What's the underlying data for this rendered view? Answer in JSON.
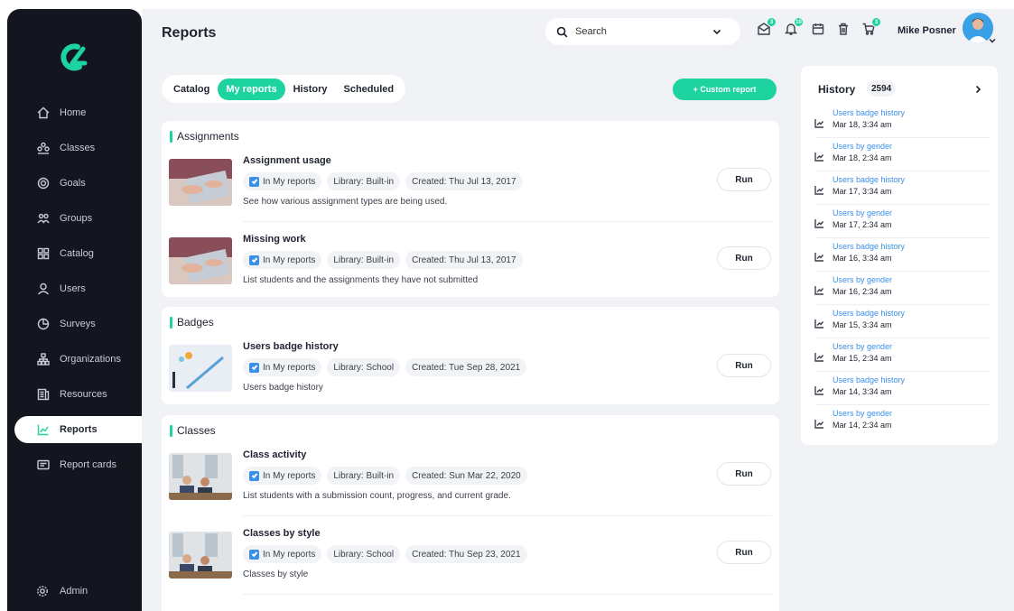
{
  "page": {
    "title": "Reports"
  },
  "sidebar": {
    "items": [
      {
        "label": "Home",
        "icon": "home-icon"
      },
      {
        "label": "Classes",
        "icon": "classes-icon"
      },
      {
        "label": "Goals",
        "icon": "goals-icon"
      },
      {
        "label": "Groups",
        "icon": "groups-icon"
      },
      {
        "label": "Catalog",
        "icon": "catalog-icon"
      },
      {
        "label": "Users",
        "icon": "user-icon"
      },
      {
        "label": "Surveys",
        "icon": "surveys-icon"
      },
      {
        "label": "Organizations",
        "icon": "organizations-icon"
      },
      {
        "label": "Resources",
        "icon": "resources-icon"
      },
      {
        "label": "Reports",
        "icon": "reports-icon",
        "active": true
      },
      {
        "label": "Report cards",
        "icon": "report-cards-icon"
      }
    ],
    "admin_label": "Admin"
  },
  "topbar": {
    "search_placeholder": "Search",
    "user_name": "Mike Posner",
    "badges": {
      "messages": "3",
      "notifications": "10",
      "cart": "3"
    }
  },
  "tabs": [
    {
      "label": "Catalog",
      "active": false
    },
    {
      "label": "My reports",
      "active": true
    },
    {
      "label": "History",
      "active": false
    },
    {
      "label": "Scheduled",
      "active": false
    }
  ],
  "custom_report_label": "+ Custom report",
  "sections": [
    {
      "title": "Assignments",
      "reports": [
        {
          "title": "Assignment usage",
          "in_my_reports": "In My reports",
          "library": "Library: Built-in",
          "created": "Created: Thu Jul 13, 2017",
          "description": "See how various assignment types are being used.",
          "run": "Run"
        },
        {
          "title": "Missing work",
          "in_my_reports": "In My reports",
          "library": "Library: Built-in",
          "created": "Created: Thu Jul 13, 2017",
          "description": "List students and the assignments they have not submitted",
          "run": "Run"
        }
      ]
    },
    {
      "title": "Badges",
      "reports": [
        {
          "title": "Users badge history",
          "in_my_reports": "In My reports",
          "library": "Library: School",
          "created": "Created: Tue Sep 28, 2021",
          "description": "Users badge history",
          "run": "Run"
        }
      ]
    },
    {
      "title": "Classes",
      "reports": [
        {
          "title": "Class activity",
          "in_my_reports": "In My reports",
          "library": "Library: Built-in",
          "created": "Created: Sun Mar 22, 2020",
          "description": "List students with a submission count, progress, and current grade.",
          "run": "Run"
        },
        {
          "title": "Classes by style",
          "in_my_reports": "In My reports",
          "library": "Library: School",
          "created": "Created: Thu Sep 23, 2021",
          "description": "Classes by style",
          "run": "Run"
        }
      ]
    }
  ],
  "history": {
    "title": "History",
    "count": "2594",
    "items": [
      {
        "name": "Users badge history",
        "date": "Mar 18, 3:34 am"
      },
      {
        "name": "Users by gender",
        "date": "Mar 18, 2:34 am"
      },
      {
        "name": "Users badge history",
        "date": "Mar 17, 3:34 am"
      },
      {
        "name": "Users by gender",
        "date": "Mar 17, 2:34 am"
      },
      {
        "name": "Users badge history",
        "date": "Mar 16, 3:34 am"
      },
      {
        "name": "Users by gender",
        "date": "Mar 16, 2:34 am"
      },
      {
        "name": "Users badge history",
        "date": "Mar 15, 3:34 am"
      },
      {
        "name": "Users by gender",
        "date": "Mar 15, 2:34 am"
      },
      {
        "name": "Users badge history",
        "date": "Mar 14, 3:34 am"
      },
      {
        "name": "Users by gender",
        "date": "Mar 14, 2:34 am"
      }
    ]
  },
  "colors": {
    "accent": "#1dd3a0",
    "sidebar": "#14161f",
    "link": "#3a8fe6",
    "background": "#f1f2f6"
  }
}
